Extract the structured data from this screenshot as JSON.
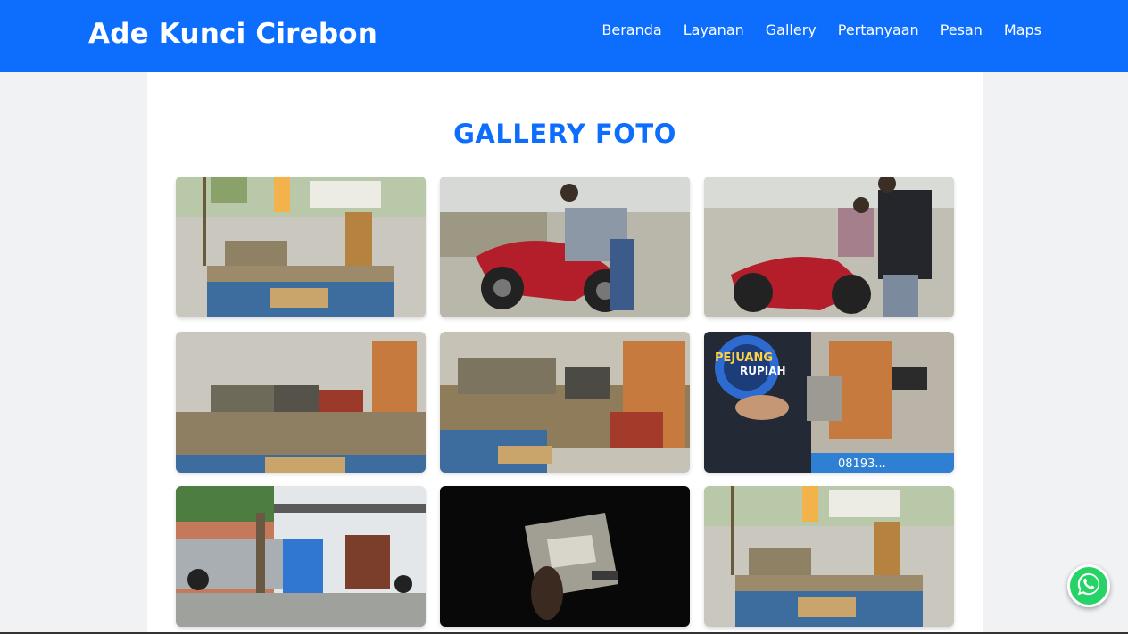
{
  "navbar": {
    "brand": "Ade Kunci Cirebon",
    "links": [
      "Beranda",
      "Layanan",
      "Gallery",
      "Pertanyaan",
      "Pesan",
      "Maps"
    ]
  },
  "gallery": {
    "title": "GALLERY FOTO",
    "photos": [
      {
        "description": "key cutting workbench"
      },
      {
        "description": "man with red motorcycle"
      },
      {
        "description": "two men with motorcycle"
      },
      {
        "description": "key cutting machines"
      },
      {
        "description": "key cutting machines close"
      },
      {
        "description": "man in Pejuang Rupiah shirt"
      },
      {
        "description": "blue kiosk cart under tree"
      },
      {
        "description": "working at night with flashlight"
      },
      {
        "description": "key cutting workbench by street"
      }
    ],
    "overlay_texts": {
      "shirt_line1": "PEJUANG",
      "shirt_line2": "RUPIAH",
      "phone": "08193..."
    }
  },
  "floating": {
    "whatsapp_icon": "whatsapp-icon"
  },
  "colors": {
    "primary": "#0d6efd",
    "whatsapp": "#25d366"
  }
}
